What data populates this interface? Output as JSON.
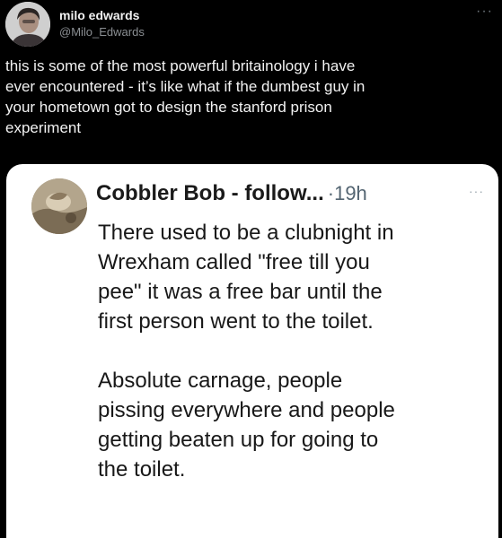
{
  "outer_tweet": {
    "author": {
      "display_name": "milo edwards",
      "handle": "@Milo_Edwards",
      "avatar_icon": "profile-photo"
    },
    "more_icon": "more-dots-icon",
    "more_label": "···",
    "text": "this is some of the most powerful britainology i have\never encountered - it’s like what if the dumbest guy in\nyour hometown got to design the stanford prison\nexperiment"
  },
  "quoted_tweet": {
    "author": {
      "display_name": "Cobbler Bob - follow...",
      "avatar_icon": "profile-photo"
    },
    "separator": "·",
    "time": "19h",
    "more_icon": "more-dots-icon",
    "more_label": "···",
    "paragraphs": [
      "There used to be a clubnight in\nWrexham called \"free till you\npee\" it was a free bar until the\nfirst person went to the toilet.",
      "Absolute carnage, people\npissing everywhere and people\ngetting beaten up for going to\nthe toilet."
    ]
  },
  "colors": {
    "background": "#000000",
    "outer_text": "#f2f2f2",
    "outer_handle": "#8b8f93",
    "card_background": "#ffffff",
    "card_text": "#181818",
    "card_meta": "#536471"
  }
}
